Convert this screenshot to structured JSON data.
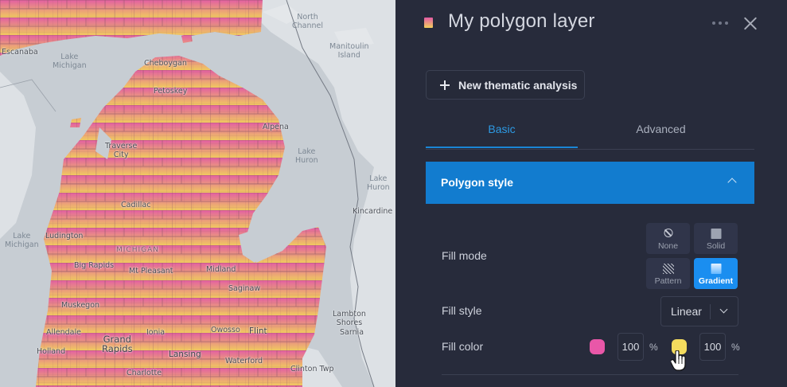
{
  "map": {
    "labels": {
      "escanaba": "Escanaba",
      "lake_michigan_1": "Lake\nMichigan",
      "cheboygan": "Cheboygan",
      "petoskey": "Petoskey",
      "north_channel": "North\nChannel",
      "manitoulin": "Manitoulin\nIsland",
      "alpena": "Alpena",
      "lake_huron_1": "Lake\nHuron",
      "lake_huron_2": "Lake\nHuron",
      "traverse_city": "Traverse\nCity",
      "cadillac": "Cadillac",
      "kincardine": "Kincardine",
      "lake_michigan_2": "Lake\nMichigan",
      "ludington": "Ludington",
      "michigan": "MICHIGAN",
      "big_rapids": "Big Rapids",
      "mt_pleasant": "Mt Pleasant",
      "midland": "Midland",
      "saginaw": "Saginaw",
      "muskegon": "Muskegon",
      "lambton_shores": "Lambton\nShores",
      "allendale": "Allendale",
      "ionia": "Ionia",
      "owosso": "Owosso",
      "flint": "Flint",
      "sarnia": "Sarnia",
      "grand_rapids": "Grand\nRapids",
      "holland": "Holland",
      "lansing": "Lansing",
      "charlotte": "Charlotte",
      "waterford": "Waterford",
      "clinton_twp": "Clinton Twp"
    }
  },
  "panel": {
    "title": "My polygon layer",
    "layer_swatch_colors": [
      "#e35aa5",
      "#f2d05b"
    ],
    "new_analysis_label": "New thematic analysis",
    "tabs": [
      {
        "label": "Basic",
        "active": true
      },
      {
        "label": "Advanced",
        "active": false
      }
    ],
    "section": {
      "title": "Polygon style",
      "expanded": true
    },
    "fill_mode": {
      "label": "Fill mode",
      "options": [
        {
          "label": "None",
          "icon": "no-fill-icon",
          "selected": false
        },
        {
          "label": "Solid",
          "icon": "solid-fill-icon",
          "selected": false
        },
        {
          "label": "Pattern",
          "icon": "pattern-fill-icon",
          "selected": false
        },
        {
          "label": "Gradient",
          "icon": "gradient-fill-icon",
          "selected": true
        }
      ]
    },
    "fill_style": {
      "label": "Fill style",
      "value": "Linear"
    },
    "fill_color": {
      "label": "Fill color",
      "start": {
        "color": "#e957a8",
        "opacity": "100",
        "unit": "%"
      },
      "end": {
        "color": "#f4dc5e",
        "opacity": "100",
        "unit": "%"
      }
    },
    "accent_color": "#1a86d6"
  }
}
